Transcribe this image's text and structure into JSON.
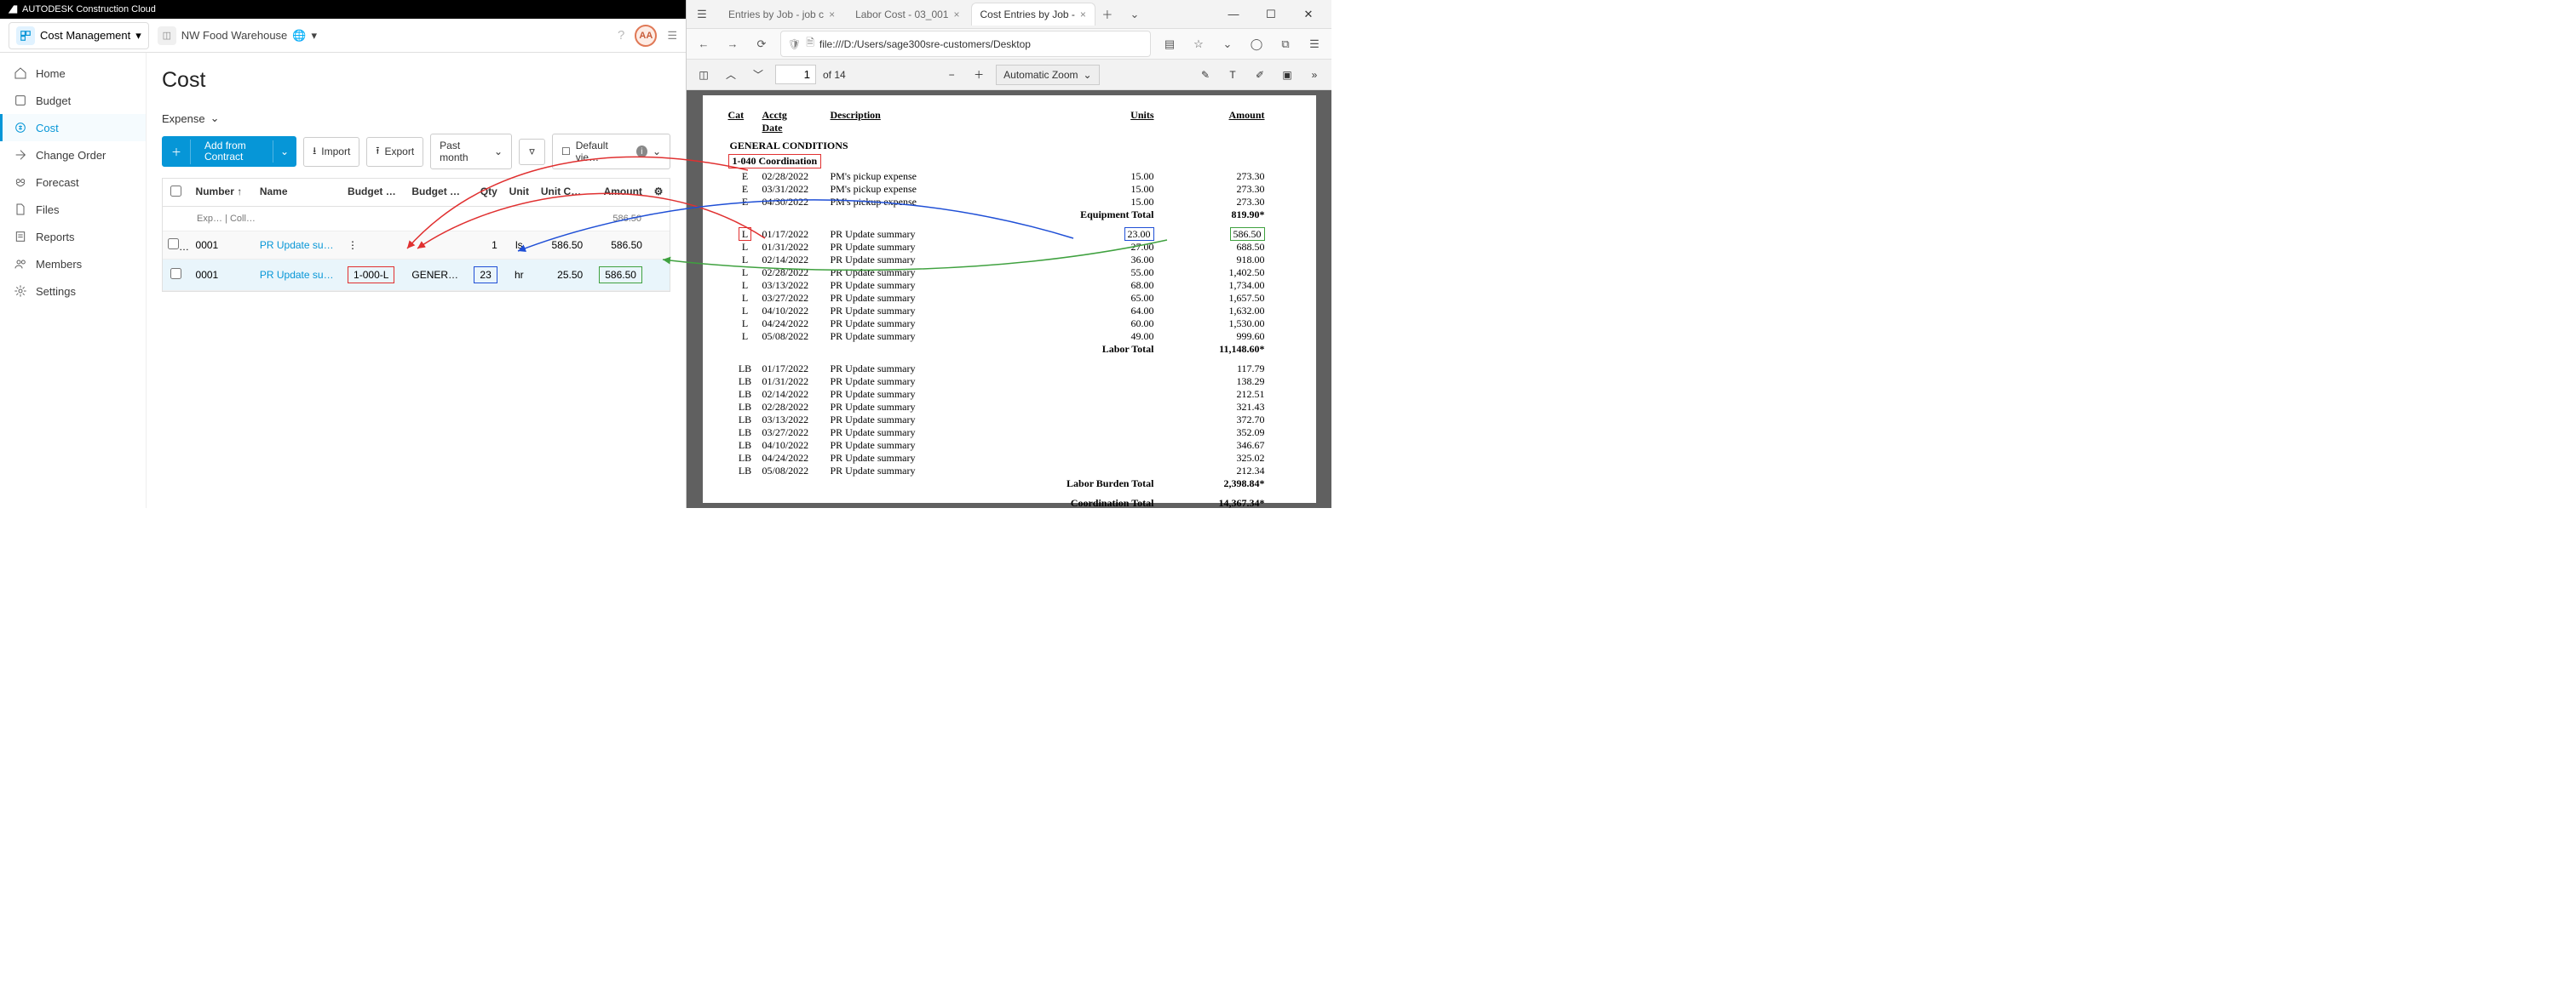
{
  "brand": "AUTODESK Construction Cloud",
  "module": {
    "name": "Cost Management"
  },
  "project": {
    "name": "NW Food Warehouse"
  },
  "avatar": "AA",
  "sidebar": {
    "items": [
      {
        "key": "home",
        "label": "Home"
      },
      {
        "key": "budget",
        "label": "Budget"
      },
      {
        "key": "cost",
        "label": "Cost"
      },
      {
        "key": "changeorder",
        "label": "Change Order"
      },
      {
        "key": "forecast",
        "label": "Forecast"
      },
      {
        "key": "files",
        "label": "Files"
      },
      {
        "key": "reports",
        "label": "Reports"
      },
      {
        "key": "members",
        "label": "Members"
      },
      {
        "key": "settings",
        "label": "Settings"
      }
    ]
  },
  "page": {
    "title": "Cost",
    "tab": "Expense"
  },
  "toolbar": {
    "add": "Add from Contract",
    "import": "Import",
    "export": "Export",
    "period": "Past month",
    "view": "Default vie…"
  },
  "grid": {
    "headers": {
      "number": "Number",
      "name": "Name",
      "bcode": "Budget Code",
      "bname": "Budget Name",
      "qty": "Qty",
      "unit": "Unit",
      "ucost": "Unit Cost",
      "amt": "Amount"
    },
    "subline": {
      "left": "Exp…",
      "right": "Coll…"
    },
    "row1": {
      "number": "0001",
      "name": "PR Update summary",
      "qty": "1",
      "unit": "ls",
      "ucost": "586.50",
      "amt": "586.50",
      "totalamt": "586.50"
    },
    "row2": {
      "number": "0001",
      "name": "PR Update summary",
      "bcode": "1-000-L",
      "bname": "GENERA…",
      "qty": "23",
      "unit": "hr",
      "ucost": "25.50",
      "amt": "586.50"
    }
  },
  "browser": {
    "tabs": [
      {
        "title": "Entries by Job - job c"
      },
      {
        "title": "Labor Cost - 03_001"
      },
      {
        "title": "Cost Entries by Job -"
      }
    ],
    "url": "file:///D:/Users/sage300sre-customers/Desktop"
  },
  "pdf": {
    "page": "1",
    "of": "of 14",
    "zoom": "Automatic Zoom",
    "headers": {
      "cat": "Cat",
      "date": "Acctg Date",
      "desc": "Description",
      "units": "Units",
      "amt": "Amount"
    },
    "section": "GENERAL CONDITIONS",
    "job": "1-040  Coordination",
    "groupE": [
      {
        "cat": "E",
        "date": "02/28/2022",
        "desc": "PM's pickup expense",
        "units": "15.00",
        "amt": "273.30"
      },
      {
        "cat": "E",
        "date": "03/31/2022",
        "desc": "PM's pickup expense",
        "units": "15.00",
        "amt": "273.30"
      },
      {
        "cat": "E",
        "date": "04/30/2022",
        "desc": "PM's pickup expense",
        "units": "15.00",
        "amt": "273.30"
      }
    ],
    "totalE": {
      "label": "Equipment  Total",
      "val": "819.90*"
    },
    "groupL": [
      {
        "cat": "L",
        "date": "01/17/2022",
        "desc": "PR Update summary",
        "units": "23.00",
        "amt": "586.50"
      },
      {
        "cat": "L",
        "date": "01/31/2022",
        "desc": "PR Update summary",
        "units": "27.00",
        "amt": "688.50"
      },
      {
        "cat": "L",
        "date": "02/14/2022",
        "desc": "PR Update summary",
        "units": "36.00",
        "amt": "918.00"
      },
      {
        "cat": "L",
        "date": "02/28/2022",
        "desc": "PR Update summary",
        "units": "55.00",
        "amt": "1,402.50"
      },
      {
        "cat": "L",
        "date": "03/13/2022",
        "desc": "PR Update summary",
        "units": "68.00",
        "amt": "1,734.00"
      },
      {
        "cat": "L",
        "date": "03/27/2022",
        "desc": "PR Update summary",
        "units": "65.00",
        "amt": "1,657.50"
      },
      {
        "cat": "L",
        "date": "04/10/2022",
        "desc": "PR Update summary",
        "units": "64.00",
        "amt": "1,632.00"
      },
      {
        "cat": "L",
        "date": "04/24/2022",
        "desc": "PR Update summary",
        "units": "60.00",
        "amt": "1,530.00"
      },
      {
        "cat": "L",
        "date": "05/08/2022",
        "desc": "PR Update summary",
        "units": "49.00",
        "amt": "999.60"
      }
    ],
    "totalL": {
      "label": "Labor  Total",
      "val": "11,148.60*"
    },
    "groupLB": [
      {
        "cat": "LB",
        "date": "01/17/2022",
        "desc": "PR Update summary",
        "units": "",
        "amt": "117.79"
      },
      {
        "cat": "LB",
        "date": "01/31/2022",
        "desc": "PR Update summary",
        "units": "",
        "amt": "138.29"
      },
      {
        "cat": "LB",
        "date": "02/14/2022",
        "desc": "PR Update summary",
        "units": "",
        "amt": "212.51"
      },
      {
        "cat": "LB",
        "date": "02/28/2022",
        "desc": "PR Update summary",
        "units": "",
        "amt": "321.43"
      },
      {
        "cat": "LB",
        "date": "03/13/2022",
        "desc": "PR Update summary",
        "units": "",
        "amt": "372.70"
      },
      {
        "cat": "LB",
        "date": "03/27/2022",
        "desc": "PR Update summary",
        "units": "",
        "amt": "352.09"
      },
      {
        "cat": "LB",
        "date": "04/10/2022",
        "desc": "PR Update summary",
        "units": "",
        "amt": "346.67"
      },
      {
        "cat": "LB",
        "date": "04/24/2022",
        "desc": "PR Update summary",
        "units": "",
        "amt": "325.02"
      },
      {
        "cat": "LB",
        "date": "05/08/2022",
        "desc": "PR Update summary",
        "units": "",
        "amt": "212.34"
      }
    ],
    "totalLB": {
      "label": "Labor Burden  Total",
      "val": "2,398.84*"
    },
    "totalCoord": {
      "label": "Coordination  Total",
      "val": "14,367.34*"
    }
  }
}
